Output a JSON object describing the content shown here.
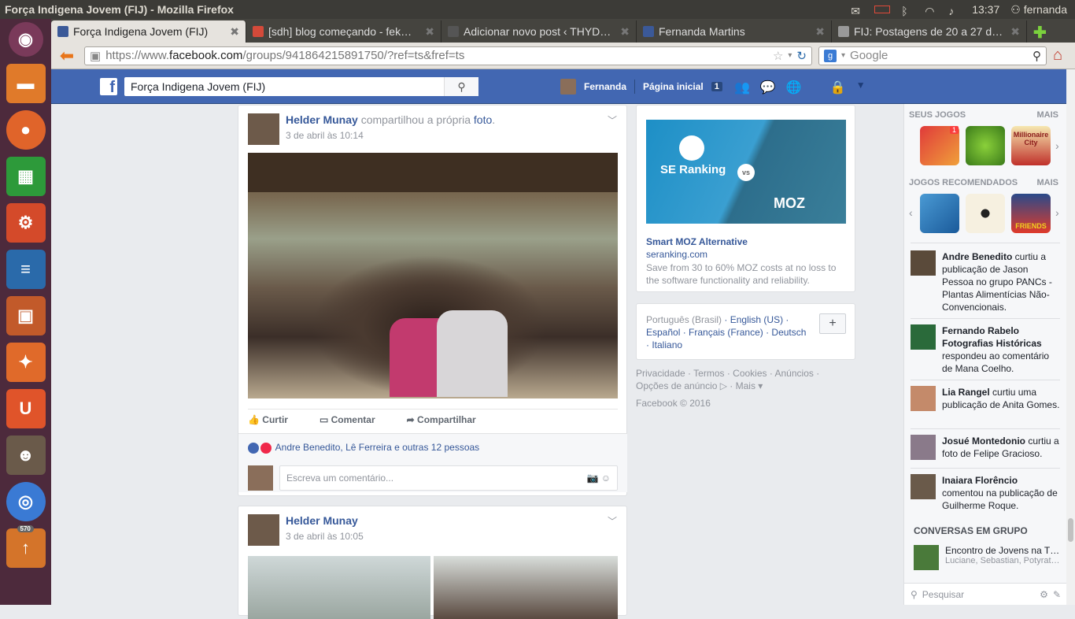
{
  "os": {
    "window_title": "Força Indigena Jovem (FIJ) - Mozilla Firefox",
    "clock": "13:37",
    "user": "fernanda",
    "launcher_badge": "570"
  },
  "browser": {
    "tabs": [
      {
        "label": "Força Indigena Jovem (FIJ)",
        "active": true
      },
      {
        "label": "[sdh] blog começando - fek…"
      },
      {
        "label": "Adicionar novo post ‹ THYD…"
      },
      {
        "label": "Fernanda Martins"
      },
      {
        "label": "FIJ: Postagens de 20 a 27 de…"
      }
    ],
    "url_prefix": "https://www.",
    "url_domain": "facebook.com",
    "url_rest": "/groups/941864215891750/?ref=ts&fref=ts",
    "search_placeholder": "Google"
  },
  "fb": {
    "search_value": "Força Indigena Jovem (FIJ)",
    "user_name": "Fernanda",
    "home_label": "Página inicial",
    "home_count": "1"
  },
  "post1": {
    "author": "Helder Munay",
    "action": " compartilhou a própria ",
    "object": "foto",
    "date": "3 de abril às 10:14",
    "like_label": "Curtir",
    "comment_label": "Comentar",
    "share_label": "Compartilhar",
    "reactions_text": "Andre Benedito, Lê Ferreira e outras 12 pessoas",
    "comment_placeholder": "Escreva um comentário..."
  },
  "post2": {
    "author": "Helder Munay",
    "date": "3 de abril às 10:05"
  },
  "ad": {
    "img_left": "SE Ranking",
    "img_vs": "vs",
    "img_right": "MOZ",
    "title": "Smart MOZ Alternative",
    "domain": "seranking.com",
    "desc": "Save from 30 to 60% MOZ costs at no loss to the software functionality and reliability."
  },
  "langs": {
    "current": "Português (Brasil)",
    "items": [
      "English (US)",
      "Español",
      "Français (France)",
      "Deutsch",
      "Italiano"
    ]
  },
  "footer": {
    "links": "Privacidade · Termos · Cookies · Anúncios · Opções de anúncio ▷ · Mais ▾",
    "copyright": "Facebook © 2016"
  },
  "ticker": {
    "games_header": "SEUS JOGOS",
    "more": "MAIS",
    "rec_header": "JOGOS RECOMENDADOS",
    "game_badge": "1",
    "game_titles": [
      "Millionaire City",
      "FRIENDS"
    ],
    "items": [
      {
        "name": "Andre Benedito",
        "text": " curtiu a publicação de Jason Pessoa no grupo PANCs - Plantas Alimentícias Não-Convencionais."
      },
      {
        "name": "Fernando Rabelo Fotografias Históricas",
        "text": " respondeu ao comentário de Mana Coelho."
      },
      {
        "name": "Lia Rangel",
        "text": " curtiu uma publicação de Anita Gomes."
      },
      {
        "name": "Josué Montedonio",
        "text": " curtiu a foto de Felipe Gracioso."
      },
      {
        "name": "Inaiara Florêncio",
        "text": " comentou na publicação de Guilherme Roque."
      }
    ],
    "conv_header": "CONVERSAS EM GRUPO",
    "conv_title": "Encontro de Jovens na T…",
    "conv_members": "Luciane, Sebastian, Potyratê, …",
    "search_placeholder": "Pesquisar"
  },
  "colors": {
    "fb_blue": "#4267b2",
    "link": "#365899",
    "ubuntu_panel": "#3c3b37",
    "launcher": "#4d2a3c"
  }
}
